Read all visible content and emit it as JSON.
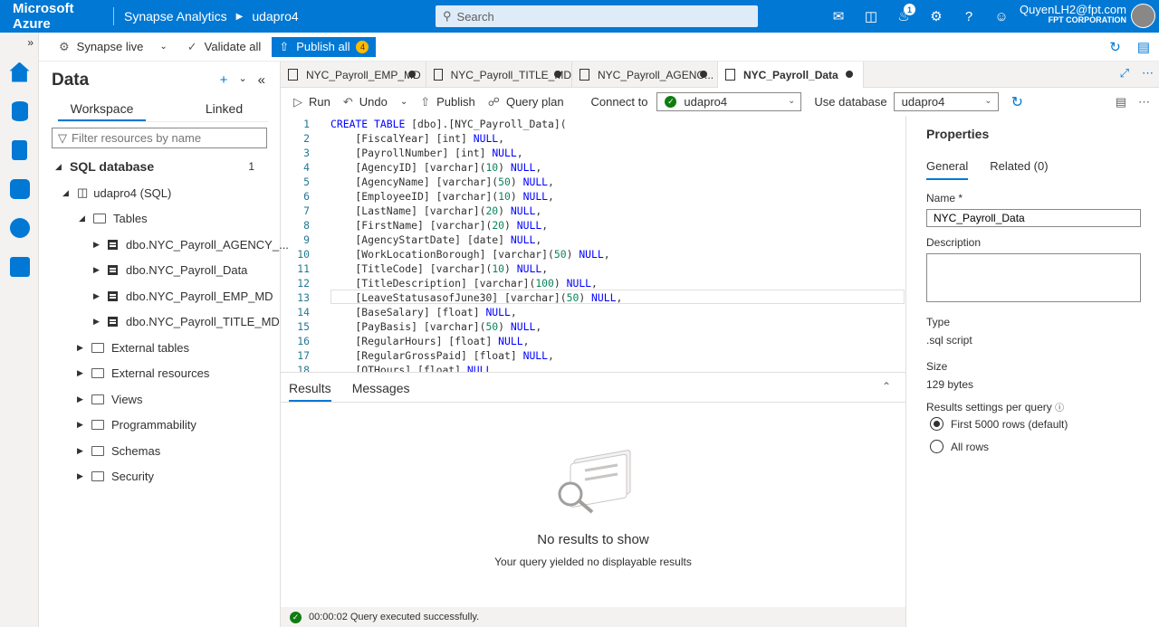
{
  "topbar": {
    "brand": "Microsoft Azure",
    "workspace": "Synapse Analytics",
    "workspace_name": "udapro4",
    "search_placeholder": "Search",
    "notifications_count": "1",
    "user_email": "QuyenLH2@fpt.com",
    "user_org": "FPT CORPORATION"
  },
  "toolbar": {
    "synapse_live": "Synapse live",
    "validate_all": "Validate all",
    "publish_all": "Publish all",
    "publish_count": "4"
  },
  "data_pane": {
    "title": "Data",
    "tabs": [
      "Workspace",
      "Linked"
    ],
    "filter_placeholder": "Filter resources by name",
    "sql_database": "SQL database",
    "sql_count": "1",
    "db": "udapro4 (SQL)",
    "tables_label": "Tables",
    "tables": [
      "dbo.NYC_Payroll_AGENCY_...",
      "dbo.NYC_Payroll_Data",
      "dbo.NYC_Payroll_EMP_MD",
      "dbo.NYC_Payroll_TITLE_MD"
    ],
    "folders": [
      "External tables",
      "External resources",
      "Views",
      "Programmability",
      "Schemas",
      "Security"
    ]
  },
  "file_tabs": [
    "NYC_Payroll_EMP_MD",
    "NYC_Payroll_TITLE_MD",
    "NYC_Payroll_AGENC...",
    "NYC_Payroll_Data"
  ],
  "editor_toolbar": {
    "run": "Run",
    "undo": "Undo",
    "publish": "Publish",
    "query_plan": "Query plan",
    "connect_to": "Connect to",
    "connect_value": "udapro4",
    "use_database": "Use database",
    "database_value": "udapro4"
  },
  "code_lines": [
    [
      "1",
      "CREATE TABLE [dbo].[NYC_Payroll_Data]("
    ],
    [
      "2",
      "    [FiscalYear] [int] NULL,"
    ],
    [
      "3",
      "    [PayrollNumber] [int] NULL,"
    ],
    [
      "4",
      "    [AgencyID] [varchar](10) NULL,"
    ],
    [
      "5",
      "    [AgencyName] [varchar](50) NULL,"
    ],
    [
      "6",
      "    [EmployeeID] [varchar](10) NULL,"
    ],
    [
      "7",
      "    [LastName] [varchar](20) NULL,"
    ],
    [
      "8",
      "    [FirstName] [varchar](20) NULL,"
    ],
    [
      "9",
      "    [AgencyStartDate] [date] NULL,"
    ],
    [
      "10",
      "    [WorkLocationBorough] [varchar](50) NULL,"
    ],
    [
      "11",
      "    [TitleCode] [varchar](10) NULL,"
    ],
    [
      "12",
      "    [TitleDescription] [varchar](100) NULL,"
    ],
    [
      "13",
      "    [LeaveStatusasofJune30] [varchar](50) NULL,"
    ],
    [
      "14",
      "    [BaseSalary] [float] NULL,"
    ],
    [
      "15",
      "    [PayBasis] [varchar](50) NULL,"
    ],
    [
      "16",
      "    [RegularHours] [float] NULL,"
    ],
    [
      "17",
      "    [RegularGrossPaid] [float] NULL,"
    ],
    [
      "18",
      "    [OTHours] [float] NULL,"
    ]
  ],
  "results": {
    "tabs": [
      "Results",
      "Messages"
    ],
    "empty_title": "No results to show",
    "empty_sub": "Your query yielded no displayable results",
    "status": "00:00:02 Query executed successfully."
  },
  "properties": {
    "title": "Properties",
    "tabs": [
      "General",
      "Related (0)"
    ],
    "name_label": "Name *",
    "name_value": "NYC_Payroll_Data",
    "description_label": "Description",
    "type_label": "Type",
    "type_value": ".sql script",
    "size_label": "Size",
    "size_value": "129 bytes",
    "results_label": "Results settings per query",
    "options": [
      "First 5000 rows (default)",
      "All rows"
    ]
  }
}
